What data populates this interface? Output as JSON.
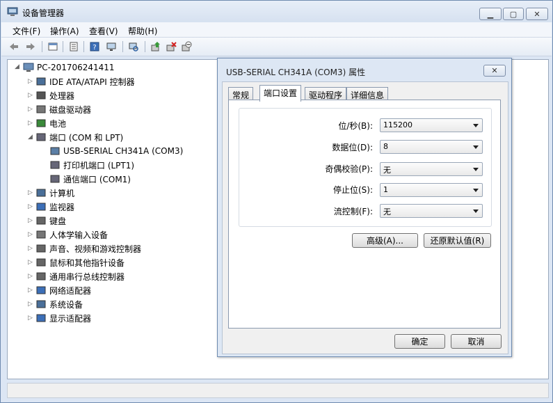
{
  "app": {
    "title": "设备管理器",
    "icon": "device-manager-icon"
  },
  "menu": [
    "文件(F)",
    "操作(A)",
    "查看(V)",
    "帮助(H)"
  ],
  "toolbar": [
    {
      "name": "back-icon"
    },
    {
      "name": "forward-icon"
    },
    {
      "name": "properties-view-icon"
    },
    {
      "name": "properties-icon"
    },
    {
      "name": "help-icon"
    },
    {
      "name": "scan-hardware-icon"
    },
    {
      "name": "update-driver-icon"
    },
    {
      "name": "uninstall-icon"
    },
    {
      "name": "disable-icon"
    }
  ],
  "tree": {
    "root": "PC-201706241411",
    "items": [
      {
        "label": "IDE ATA/ATAPI 控制器",
        "level": 1,
        "expanded": false
      },
      {
        "label": "处理器",
        "level": 1,
        "expanded": false
      },
      {
        "label": "磁盘驱动器",
        "level": 1,
        "expanded": false
      },
      {
        "label": "电池",
        "level": 1,
        "expanded": false
      },
      {
        "label": "端口 (COM 和 LPT)",
        "level": 1,
        "expanded": true
      },
      {
        "label": "USB-SERIAL CH341A (COM3)",
        "level": 2
      },
      {
        "label": "打印机端口 (LPT1)",
        "level": 2
      },
      {
        "label": "通信端口 (COM1)",
        "level": 2
      },
      {
        "label": "计算机",
        "level": 1,
        "expanded": false
      },
      {
        "label": "监视器",
        "level": 1,
        "expanded": false
      },
      {
        "label": "键盘",
        "level": 1,
        "expanded": false
      },
      {
        "label": "人体学输入设备",
        "level": 1,
        "expanded": false
      },
      {
        "label": "声音、视频和游戏控制器",
        "level": 1,
        "expanded": false
      },
      {
        "label": "鼠标和其他指针设备",
        "level": 1,
        "expanded": false
      },
      {
        "label": "通用串行总线控制器",
        "level": 1,
        "expanded": false
      },
      {
        "label": "网络适配器",
        "level": 1,
        "expanded": false
      },
      {
        "label": "系统设备",
        "level": 1,
        "expanded": false
      },
      {
        "label": "显示适配器",
        "level": 1,
        "expanded": false
      }
    ]
  },
  "dialog": {
    "title": "USB-SERIAL CH341A (COM3) 属性",
    "tabs": [
      "常规",
      "端口设置",
      "驱动程序",
      "详细信息"
    ],
    "active_tab": "端口设置",
    "fields": [
      {
        "label": "位/秒(B):",
        "value": "115200"
      },
      {
        "label": "数据位(D):",
        "value": "8"
      },
      {
        "label": "奇偶校验(P):",
        "value": "无"
      },
      {
        "label": "停止位(S):",
        "value": "1"
      },
      {
        "label": "流控制(F):",
        "value": "无"
      }
    ],
    "advanced_button": "高级(A)...",
    "restore_button": "还原默认值(R)",
    "ok_button": "确定",
    "cancel_button": "取消"
  }
}
